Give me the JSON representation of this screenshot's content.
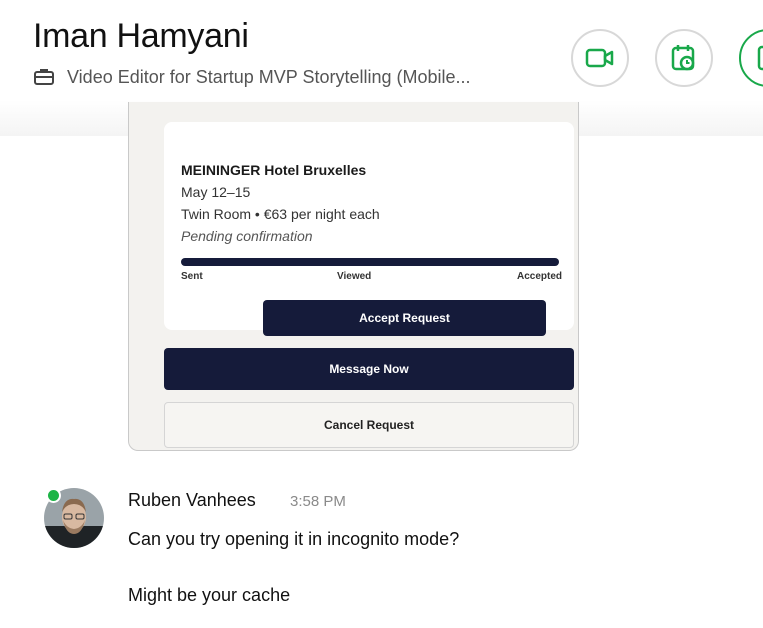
{
  "header": {
    "name": "Iman Hamyani",
    "project": "Video Editor for Startup MVP Storytelling (Mobile...",
    "icons": [
      "briefcase-icon",
      "video-call-icon",
      "schedule-icon",
      "more-icon"
    ],
    "accent_color": "#19a84a"
  },
  "screenshot_card": {
    "hotel": "MEININGER Hotel Bruxelles",
    "dates": "May 12–15",
    "room": "Twin Room • €63 per night each",
    "status": "Pending confirmation",
    "progress_steps": [
      "Sent",
      "Viewed",
      "Accepted"
    ],
    "progress_fraction": 1.0,
    "accept_label": "Accept Request",
    "message_label": "Message Now",
    "cancel_label": "Cancel Request",
    "button_color": "#151b3a"
  },
  "message": {
    "author": "Ruben Vanhees",
    "time": "3:58 PM",
    "lines": [
      "Can you try opening it in incognito mode?",
      "Might be your cache"
    ],
    "online_color": "#1db446"
  }
}
